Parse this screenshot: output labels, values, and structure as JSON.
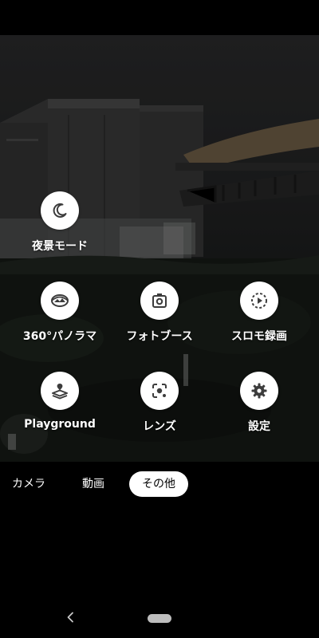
{
  "modes": [
    {
      "label": "夜景モード",
      "icon": "moon-icon"
    },
    {
      "label": "360°パノラマ",
      "icon": "panorama-icon"
    },
    {
      "label": "フォトブース",
      "icon": "photobooth-icon"
    },
    {
      "label": "スロモ録画",
      "icon": "slow-motion-icon"
    },
    {
      "label": "Playground",
      "icon": "playground-icon"
    },
    {
      "label": "レンズ",
      "icon": "lens-icon"
    },
    {
      "label": "設定",
      "icon": "gear-icon"
    }
  ],
  "tabs": [
    {
      "label": "カメラ",
      "active": false
    },
    {
      "label": "動画",
      "active": false
    },
    {
      "label": "その他",
      "active": true
    }
  ],
  "nav": {
    "back": "back-icon",
    "home": "home-pill"
  },
  "colors": {
    "accent": "#ffffff",
    "background": "#000000",
    "icon": "#3c3c3c"
  }
}
